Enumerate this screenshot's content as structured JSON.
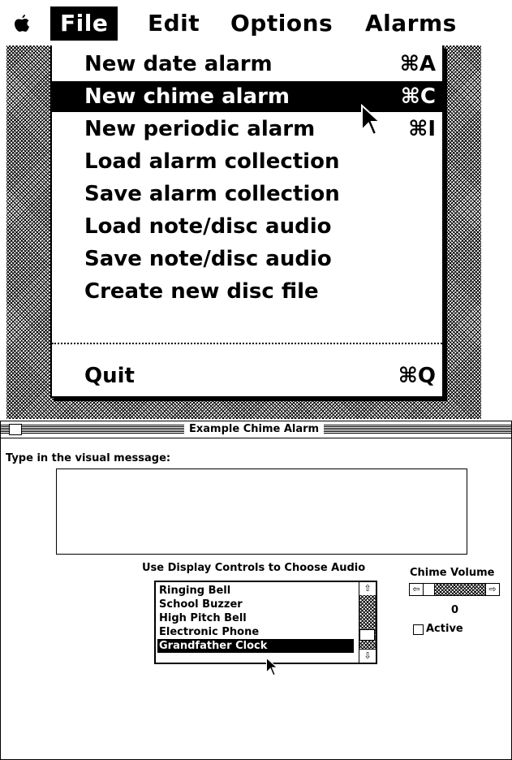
{
  "menubar": {
    "apple_glyph": "",
    "items": [
      {
        "label": "File",
        "selected": true
      },
      {
        "label": "Edit",
        "selected": false
      },
      {
        "label": "Options",
        "selected": false
      },
      {
        "label": "Alarms",
        "selected": false
      }
    ]
  },
  "file_menu": {
    "items": [
      {
        "label": "New date alarm",
        "shortcut": "⌘A"
      },
      {
        "label": "New chime alarm",
        "shortcut": "⌘C",
        "selected": true
      },
      {
        "label": "New periodic alarm",
        "shortcut": "⌘I"
      },
      {
        "label": "Load alarm collection",
        "shortcut": ""
      },
      {
        "label": "Save alarm collection",
        "shortcut": ""
      },
      {
        "label": "Load note/disc audio",
        "shortcut": ""
      },
      {
        "label": "Save note/disc audio",
        "shortcut": ""
      },
      {
        "label": "Create new disc file",
        "shortcut": ""
      }
    ],
    "quit": {
      "label": "Quit",
      "shortcut": "⌘Q"
    }
  },
  "window": {
    "title": "Example Chime Alarm",
    "message_label": "Type in the visual message:",
    "message_value": "",
    "audio_label": "Use Display Controls to Choose Audio",
    "audio_list": {
      "items": [
        "Ringing Bell",
        "School Buzzer",
        "High Pitch Bell",
        "Electronic Phone",
        "Grandfather Clock"
      ],
      "selected": "Grandfather Clock"
    },
    "volume_label": "Chime Volume",
    "volume_value": "0",
    "active_label": "Active",
    "active_checked": false
  }
}
